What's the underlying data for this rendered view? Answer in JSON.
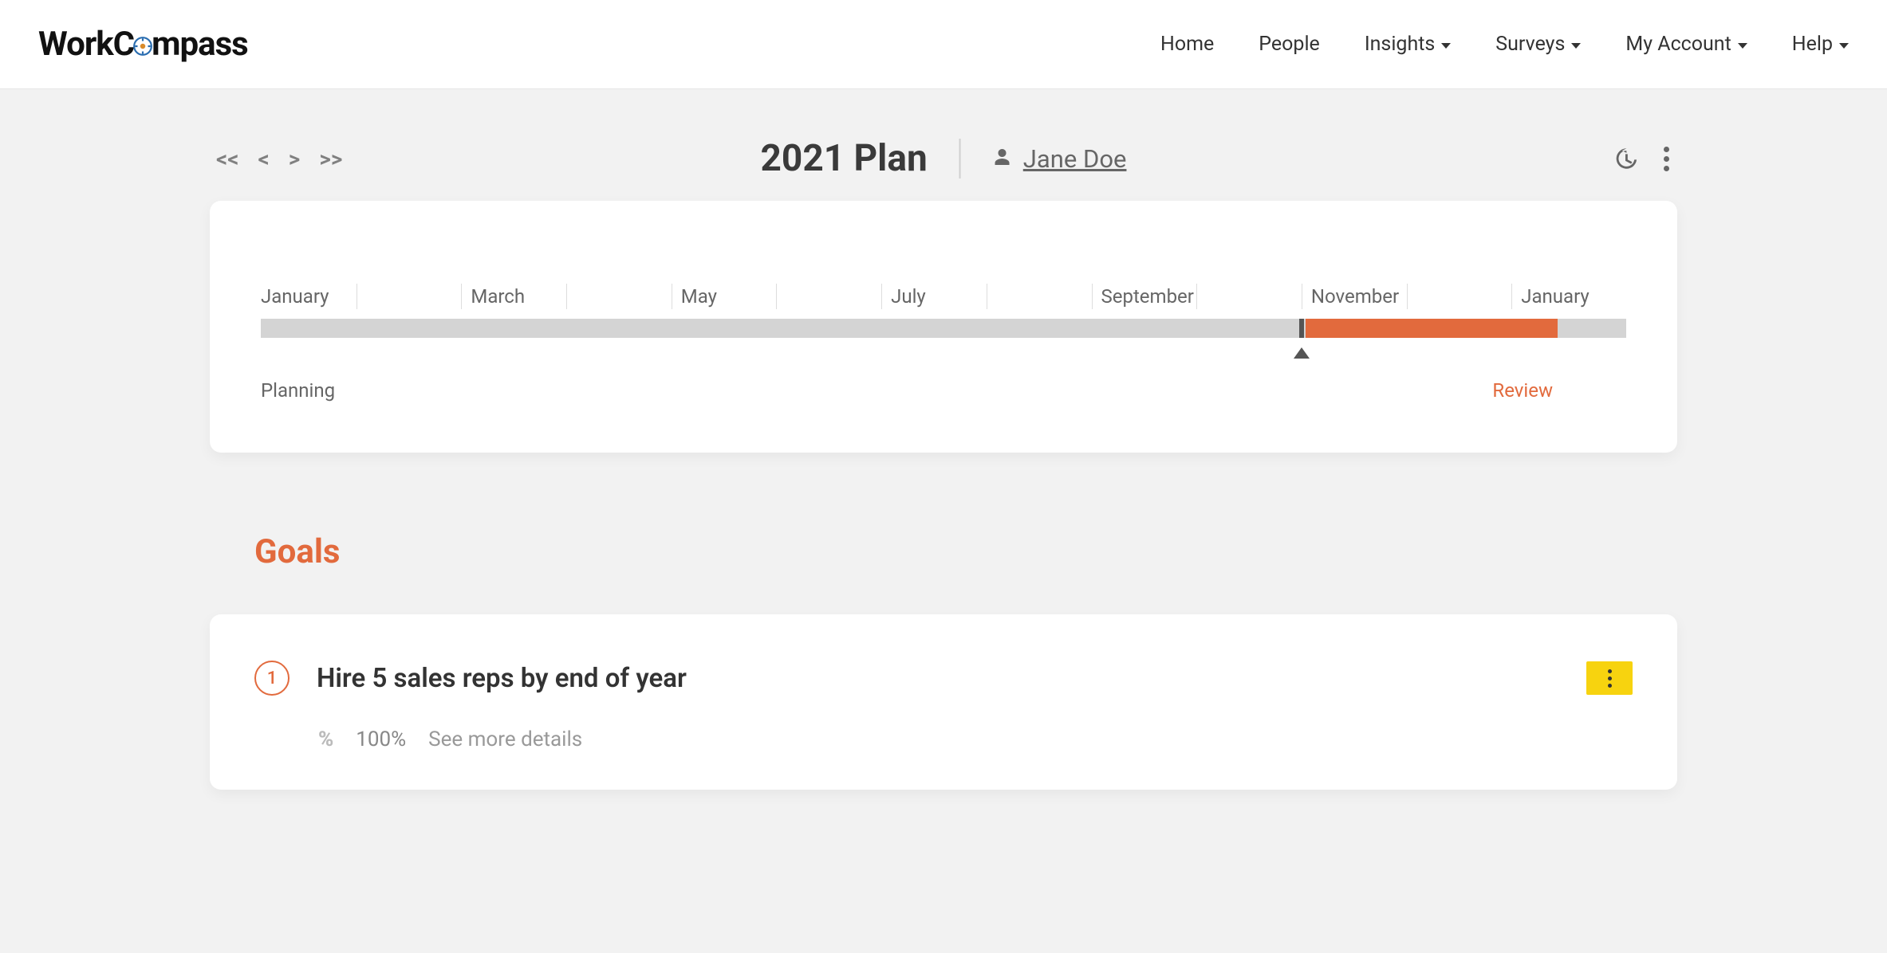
{
  "brand": {
    "pre": "WorkC",
    "post": "mpass"
  },
  "nav": {
    "home": "Home",
    "people": "People",
    "insights": "Insights",
    "surveys": "Surveys",
    "my_account": "My Account",
    "help": "Help"
  },
  "plan": {
    "nav": {
      "first": "<<",
      "prev": "<",
      "next": ">",
      "last": ">>"
    },
    "title": "2021 Plan",
    "person_name": "Jane Doe"
  },
  "timeline": {
    "months": [
      "January",
      "",
      "March",
      "",
      "May",
      "",
      "July",
      "",
      "September",
      "",
      "November",
      "",
      "January"
    ],
    "progress_orange_start_pct": 76.5,
    "progress_orange_end_pct": 95,
    "current_marker_pct": 76.2,
    "planning_label": "Planning",
    "review_label": "Review"
  },
  "sections": {
    "goals": "Goals"
  },
  "goals": [
    {
      "number": "1",
      "title": "Hire 5 sales reps by end of year",
      "percent": "100%",
      "see_more": "See more details"
    }
  ]
}
